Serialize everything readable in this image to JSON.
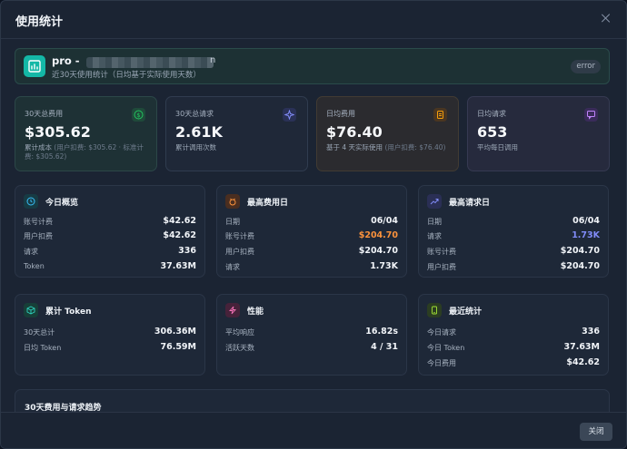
{
  "modal": {
    "title": "使用统计",
    "close_button": "关闭"
  },
  "account": {
    "name": "pro -",
    "name_tail": "n",
    "subtitle": "近30天使用统计（日均基于实际使用天数）",
    "status": "error"
  },
  "stats": [
    {
      "label": "30天总费用",
      "value": "$305.62",
      "sub": "累计成本",
      "sub_extra": "(用户扣费: $305.62 · 标准计费: $305.62)",
      "icon": "dollar-icon",
      "color": "#22c55e"
    },
    {
      "label": "30天总请求",
      "value": "2.61K",
      "sub": "累计调用次数",
      "sub_extra": "",
      "icon": "sparkle-icon",
      "color": "#6366f1"
    },
    {
      "label": "日均费用",
      "value": "$76.40",
      "sub": "基于 4 天实际使用",
      "sub_extra": "(用户扣费: $76.40)",
      "icon": "clipboard-icon",
      "color": "#f59e0b"
    },
    {
      "label": "日均请求",
      "value": "653",
      "sub": "平均每日调用",
      "sub_extra": "",
      "icon": "chat-icon",
      "color": "#a855f7"
    }
  ],
  "today": {
    "title": "今日概览",
    "icon": "clock-icon",
    "rows": [
      {
        "label": "账号计费",
        "value": "$42.62"
      },
      {
        "label": "用户扣费",
        "value": "$42.62"
      },
      {
        "label": "请求",
        "value": "336"
      },
      {
        "label": "Token",
        "value": "37.63M"
      }
    ]
  },
  "top_cost_day": {
    "title": "最高费用日",
    "icon": "bag-icon",
    "rows": [
      {
        "label": "日期",
        "value": "06/04"
      },
      {
        "label": "账号计费",
        "value": "$204.70"
      },
      {
        "label": "用户扣费",
        "value": "$204.70"
      },
      {
        "label": "请求",
        "value": "1.73K"
      }
    ]
  },
  "top_request_day": {
    "title": "最高请求日",
    "icon": "trending-up-icon",
    "rows": [
      {
        "label": "日期",
        "value": "06/04"
      },
      {
        "label": "请求",
        "value": "1.73K"
      },
      {
        "label": "账号计费",
        "value": "$204.70"
      },
      {
        "label": "用户扣费",
        "value": "$204.70"
      }
    ]
  },
  "tokens": {
    "title": "累计 Token",
    "icon": "cube-icon",
    "rows": [
      {
        "label": "30天总计",
        "value": "306.36M"
      },
      {
        "label": "日均 Token",
        "value": "76.59M"
      }
    ]
  },
  "performance": {
    "title": "性能",
    "icon": "bolt-icon",
    "rows": [
      {
        "label": "平均响应",
        "value": "16.82s"
      },
      {
        "label": "活跃天数",
        "value": "4 / 31"
      }
    ]
  },
  "recent": {
    "title": "最近统计",
    "icon": "phone-icon",
    "rows": [
      {
        "label": "今日请求",
        "value": "336"
      },
      {
        "label": "今日 Token",
        "value": "37.63M"
      },
      {
        "label": "今日费用",
        "value": "$42.62"
      }
    ]
  },
  "trend": {
    "title": "30天费用与请求趋势"
  },
  "colors": {
    "accent_teal": "#14b8a6",
    "orange": "#fb923c",
    "indigo": "#818cf8"
  }
}
